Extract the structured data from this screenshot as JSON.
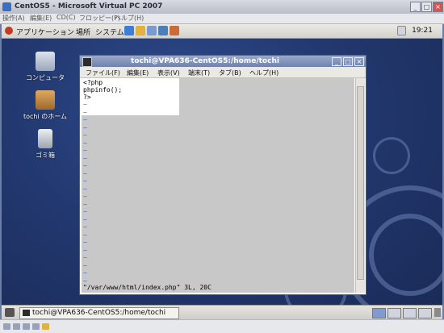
{
  "vpc": {
    "title": "CentOS5 - Microsoft Virtual PC 2007",
    "menu": [
      "操作(A)",
      "編集(E)",
      "CD(C)",
      "フロッピー(F)",
      "ヘルプ(H)"
    ]
  },
  "panel": {
    "menus": [
      "アプリケーション",
      "場所",
      "システム"
    ],
    "clock": "19:21"
  },
  "desktop_icons": [
    "コンピュータ",
    "tochi のホーム",
    "ゴミ箱"
  ],
  "window": {
    "title": "tochi@VPA636-CentOS5:/home/tochi",
    "menu": [
      "ファイル(F)",
      "編集(E)",
      "表示(V)",
      "端末(T)",
      "タブ(B)",
      "ヘルプ(H)"
    ],
    "lines": [
      "<?php",
      "phpinfo();",
      "?>"
    ],
    "tilde": "~",
    "status": "\"/var/www/html/index.php\" 3L, 20C"
  },
  "taskbar": {
    "task": "tochi@VPA636-CentOS5:/home/tochi"
  },
  "colors": {
    "desktop": "#22386f",
    "titlebar": "#7b8db4",
    "terminal_bg": "#c8c8c8"
  }
}
